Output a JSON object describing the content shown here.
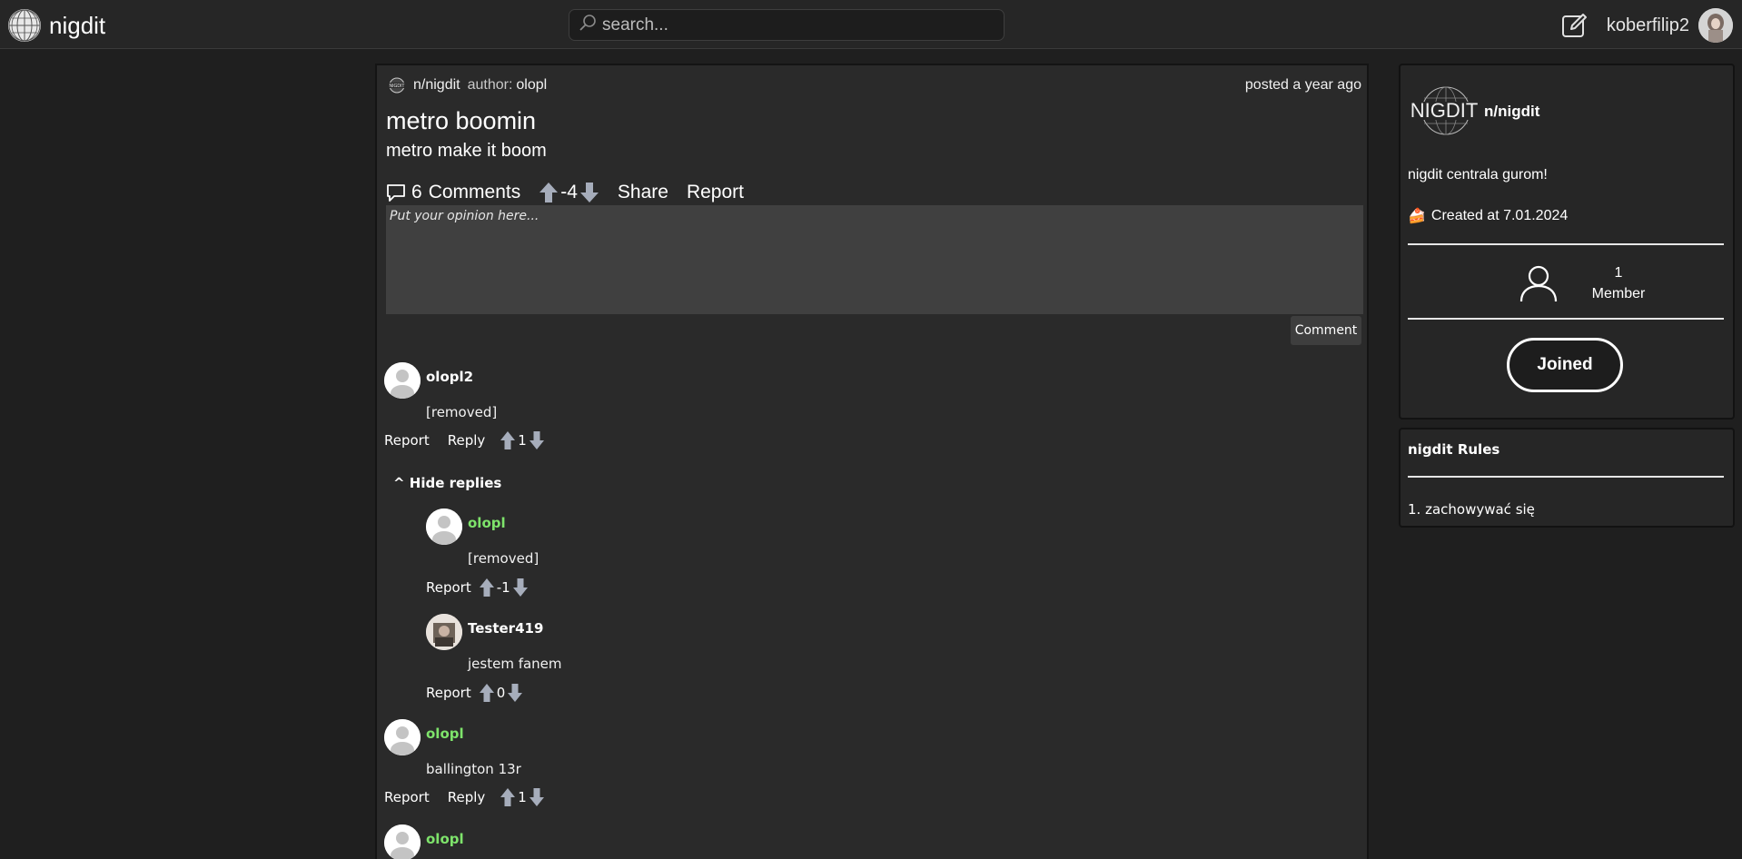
{
  "header": {
    "site_name": "nigdit",
    "search_placeholder": "search...",
    "username": "koberfilip2"
  },
  "post": {
    "community": "n/nigdit",
    "author_label": "author:",
    "author": "olopl",
    "posted": "posted a year ago",
    "title": "metro boomin",
    "body": "metro make it boom",
    "comment_count": "6",
    "comments_label": "Comments",
    "score": "-4",
    "share_label": "Share",
    "report_label": "Report",
    "comment_placeholder": "Put your opinion here...",
    "comment_button": "Comment"
  },
  "comments": {
    "hide_replies": "^ Hide replies",
    "report": "Report",
    "reply": "Reply",
    "c1": {
      "author": "olopl2",
      "text": "[removed]",
      "score": "1"
    },
    "r1": {
      "author": "olopl",
      "text": "[removed]",
      "score": "-1"
    },
    "r2": {
      "author": "Tester419",
      "text": "jestem fanem",
      "score": "0"
    },
    "c2": {
      "author": "olopl",
      "text": "ballington 13r",
      "score": "1"
    },
    "c3": {
      "author": "olopl"
    }
  },
  "sidebar": {
    "logo_text": "NIGDIT",
    "community": "n/nigdit",
    "description": "nigdit centrala gurom!",
    "created_icon": "🍰",
    "created": "Created at 7.01.2024",
    "member_count": "1",
    "member_label": "Member",
    "joined_label": "Joined",
    "rules_title": "nigdit Rules",
    "rules": [
      "1. zachowywać się"
    ]
  },
  "colors": {
    "background": "#1f1f1f",
    "panel": "#2a2a2a",
    "mod_green": "#7ee36b",
    "arrow_gray": "#a6adbb"
  }
}
